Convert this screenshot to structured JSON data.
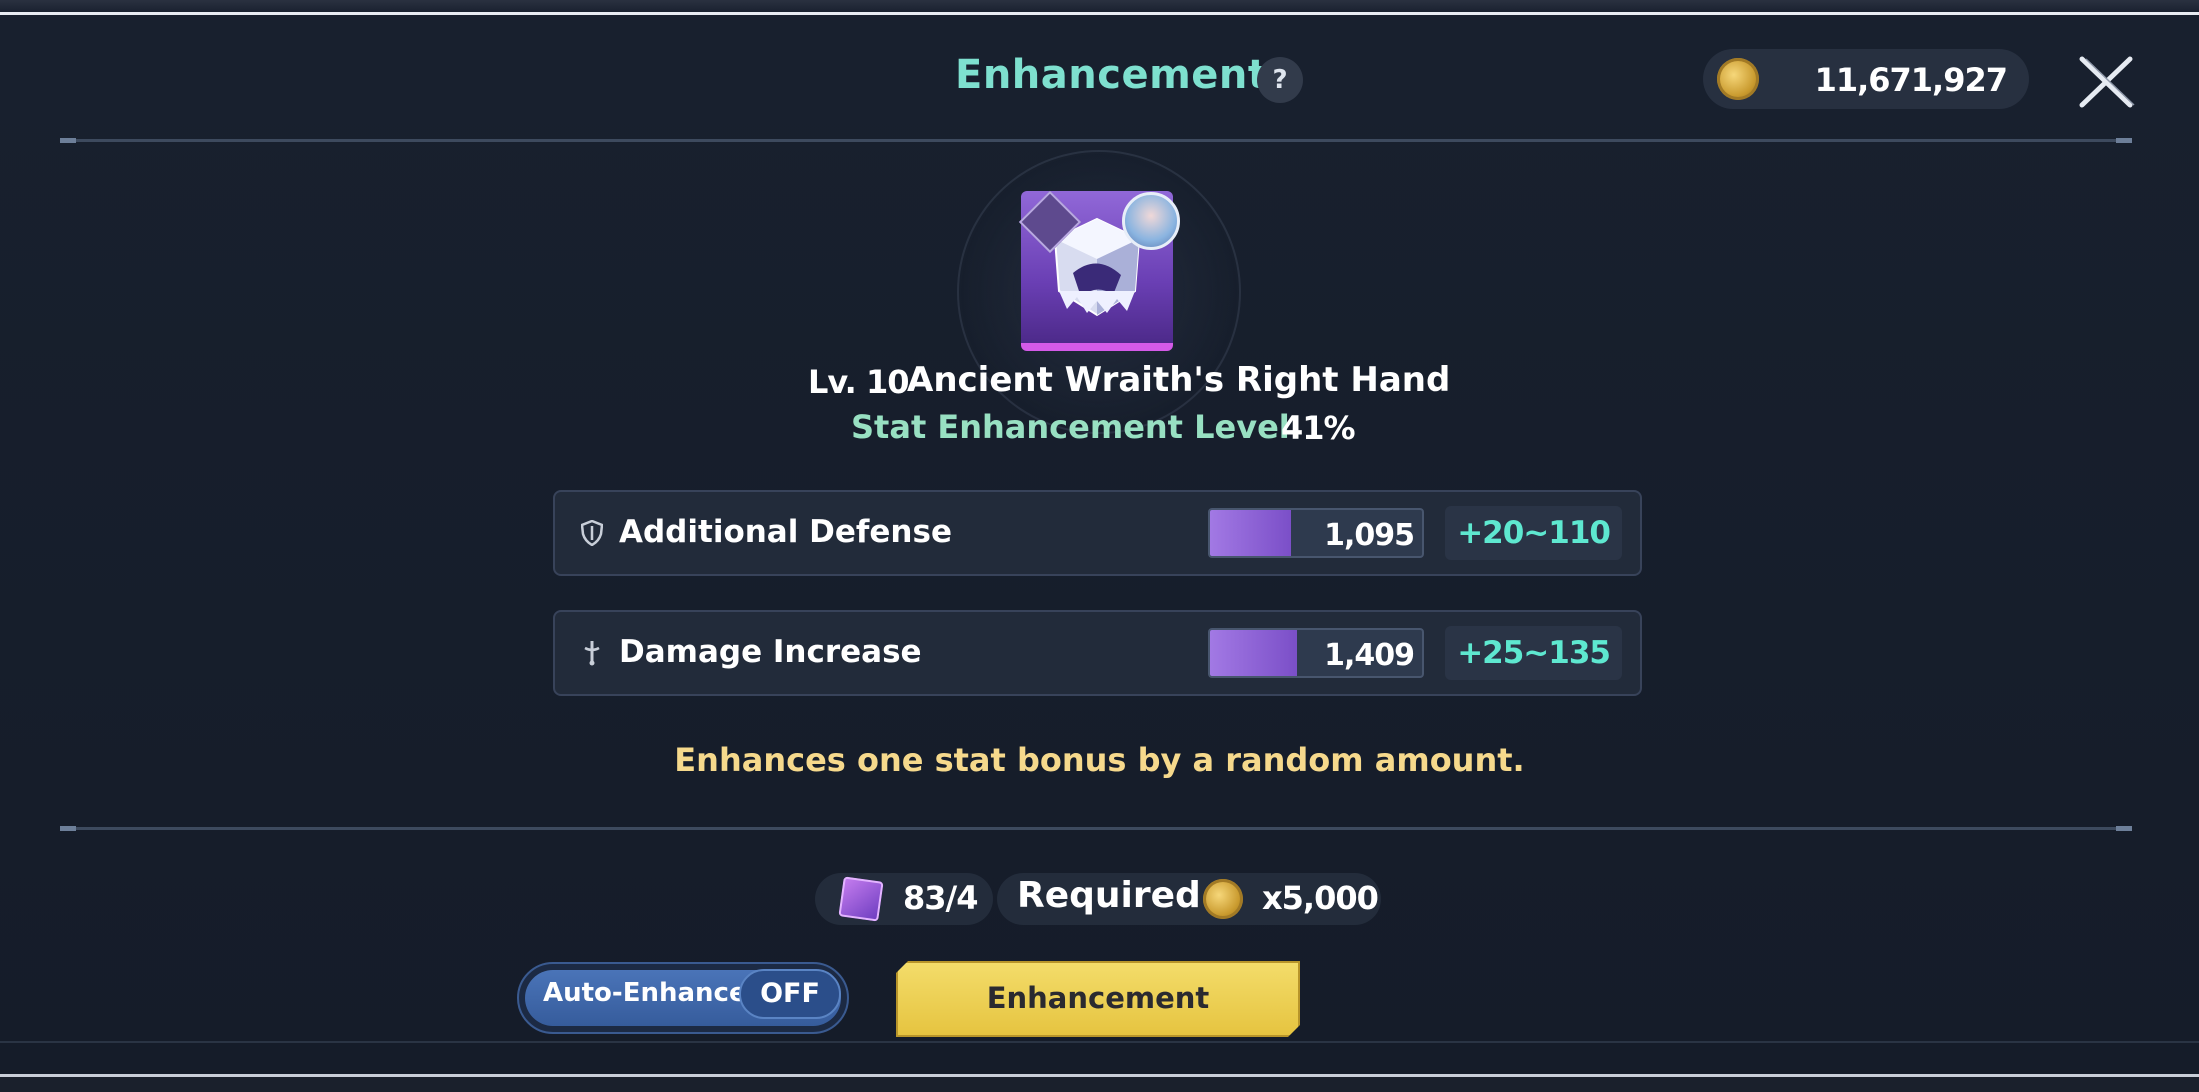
{
  "header": {
    "title": "Enhancement",
    "help_label": "?",
    "coin_balance": "11,671,927"
  },
  "item": {
    "level": "Lv. 10",
    "name": "Ancient Wraith's Right Hand",
    "stat_enhancement_label": "Stat Enhancement Level",
    "stat_enhancement_value": "41%"
  },
  "stats": [
    {
      "name": "Additional Defense",
      "value": "1,095",
      "range": "+20~110",
      "fill_fraction": 0.38,
      "icon": "shield-icon"
    },
    {
      "name": "Damage Increase",
      "value": "1,409",
      "range": "+25~135",
      "fill_fraction": 0.41,
      "icon": "sword-icon"
    }
  ],
  "note": "Enhances one stat bonus by a random amount.",
  "cost": {
    "material_count": "83/4",
    "required_label": "Required",
    "coin_amount": "x5,000"
  },
  "controls": {
    "auto_label": "Auto-Enhance",
    "auto_state": "OFF",
    "enhance_label": "Enhancement"
  },
  "colors": {
    "title": "#7ee0cf",
    "range": "#5ee8d0",
    "note": "#f6d98c",
    "button": "#e6c440"
  }
}
